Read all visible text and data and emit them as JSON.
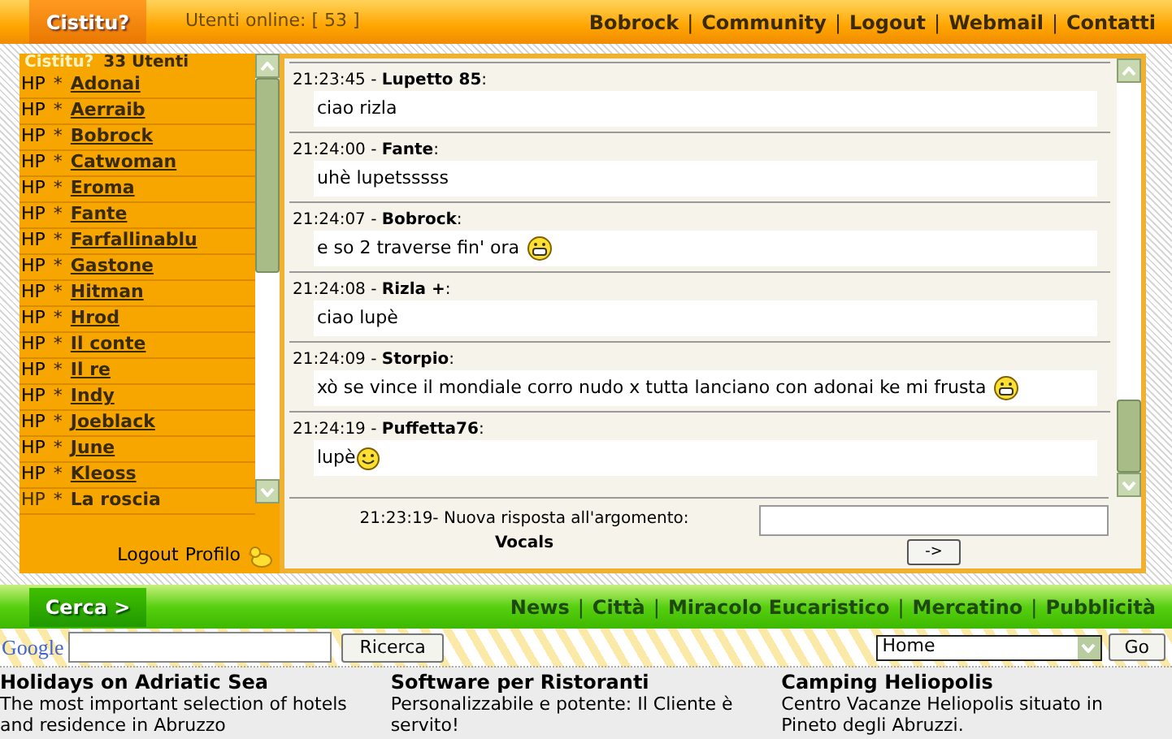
{
  "header": {
    "logo": "Cistitu?",
    "online": "Utenti online: [ 53 ]",
    "links": [
      {
        "kind": "link",
        "text": "Bobrock"
      },
      {
        "kind": "separator",
        "text": "|"
      },
      {
        "kind": "link",
        "text": "Community"
      },
      {
        "kind": "separator",
        "text": "|"
      },
      {
        "kind": "link",
        "text": "Logout"
      },
      {
        "kind": "separator",
        "text": "|"
      },
      {
        "kind": "link",
        "text": "Webmail"
      },
      {
        "kind": "separator",
        "text": "|"
      },
      {
        "kind": "link",
        "text": "Contatti"
      }
    ]
  },
  "sidebar": {
    "title": "Cistitu?",
    "count": "33 Utenti",
    "users": [
      {
        "hp": "HP",
        "name": "Adonai",
        "linked": true
      },
      {
        "hp": "HP",
        "name": "Aerraib",
        "linked": true
      },
      {
        "hp": "HP",
        "name": "Bobrock",
        "linked": true
      },
      {
        "hp": "HP",
        "name": "Catwoman",
        "linked": true
      },
      {
        "hp": "HP",
        "name": "Eroma",
        "linked": true
      },
      {
        "hp": "HP",
        "name": "Fante",
        "linked": true
      },
      {
        "hp": "HP",
        "name": "Farfallinablu",
        "linked": true
      },
      {
        "hp": "HP",
        "name": "Gastone",
        "linked": true
      },
      {
        "hp": "HP",
        "name": "Hitman",
        "linked": true
      },
      {
        "hp": "HP",
        "name": "Hrod",
        "linked": true
      },
      {
        "hp": "HP",
        "name": "Il conte",
        "linked": true
      },
      {
        "hp": "HP",
        "name": "Il re",
        "linked": true
      },
      {
        "hp": "HP",
        "name": "Indy",
        "linked": true
      },
      {
        "hp": "HP",
        "name": "Joeblack",
        "linked": true
      },
      {
        "hp": "HP",
        "name": "June",
        "linked": true
      },
      {
        "hp": "HP",
        "name": "Kleoss",
        "linked": true
      },
      {
        "hp": "HP",
        "name": "La roscia",
        "linked": false
      }
    ],
    "bullets": [
      "*",
      "*",
      "*",
      "*",
      "*",
      "*",
      "*",
      "*",
      "*",
      "*",
      "*",
      "*",
      "*",
      "*",
      "*",
      "*",
      "*"
    ],
    "footer_links": [
      "Logout",
      "Profilo"
    ]
  },
  "chat": {
    "messages": [
      {
        "header": "21:23:45 - **Lupetto 85**:",
        "text": "ciao rizla",
        "kind": "plain"
      },
      {
        "header": "21:24:00 - **Fante**:",
        "text": "uhè lupetsssss",
        "kind": "plain"
      },
      {
        "header": "21:24:07 - **Bobrock**:",
        "text": "e so 2 traverse fin' ora",
        "kind": "grin"
      },
      {
        "header": "21:24:08 - **Rizla +**:",
        "text": "ciao lupè",
        "kind": "plain"
      },
      {
        "header": "21:24:09 - **Storpio**:",
        "text": "xò se vince il mondiale corro nudo x tutta lanciano con adonai ke mi frusta",
        "kind": "grin"
      },
      {
        "header": "21:24:19 - **Puffetta76**:",
        "text": "lupè",
        "kind": "smile"
      }
    ],
    "notice": {
      "text": "21:23:19- Nuova risposta all'argomento:",
      "topic": "Vocals"
    },
    "send_button": "->"
  },
  "nav": {
    "button": "Cerca >",
    "links": [
      {
        "kind": "link",
        "text": "News"
      },
      {
        "kind": "separator",
        "text": "|"
      },
      {
        "kind": "link",
        "text": "Città"
      },
      {
        "kind": "separator",
        "text": "|"
      },
      {
        "kind": "link",
        "text": "Miracolo Eucaristico"
      },
      {
        "kind": "separator",
        "text": "|"
      },
      {
        "kind": "link",
        "text": "Mercatino"
      },
      {
        "kind": "separator",
        "text": "|"
      },
      {
        "kind": "link",
        "text": "Pubblicità"
      }
    ]
  },
  "search": {
    "logo": "Google",
    "button": "Ricerca",
    "select": "Home",
    "go": "Go"
  },
  "ads": [
    {
      "title": "Holidays on Adriatic Sea",
      "text": "The most important selection of hotels and residence in Abruzzo"
    },
    {
      "title": "Software per Ristoranti",
      "text": "Personalizzabile e potente: Il Cliente è servito!"
    },
    {
      "title": "Camping Heliopolis",
      "text": "Centro Vacanze Heliopolis situato in Pineto degli Abruzzi."
    }
  ]
}
